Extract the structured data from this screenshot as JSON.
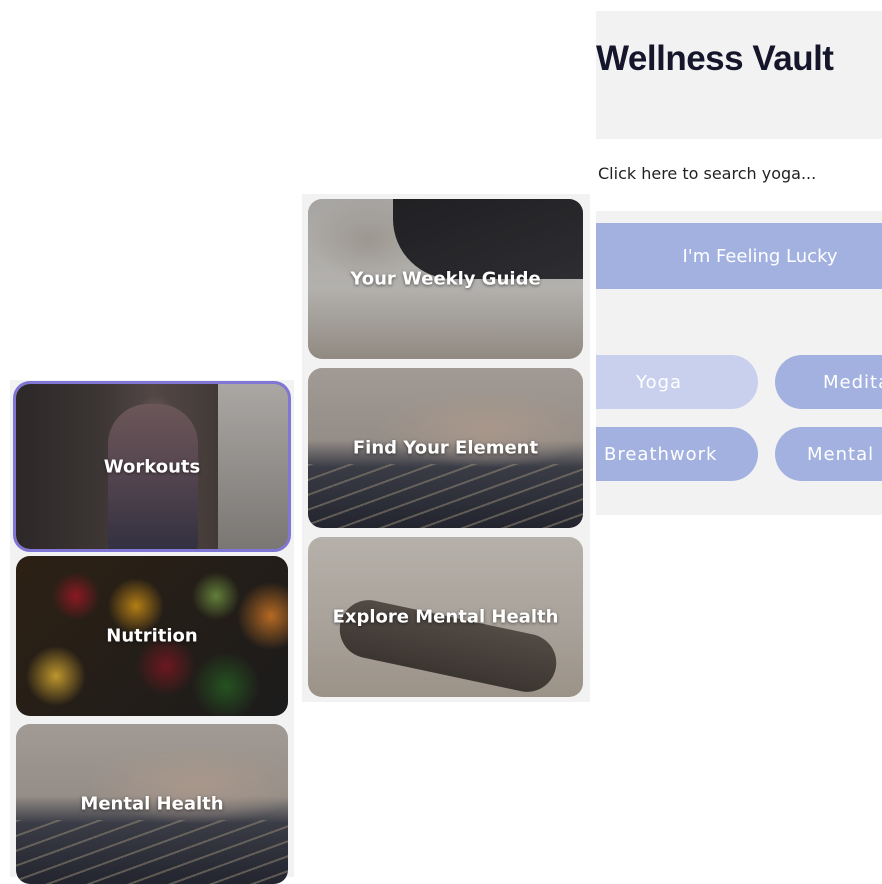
{
  "header": {
    "title": "Wellness Vault"
  },
  "search": {
    "placeholder": "Click here to search yoga..."
  },
  "actions": {
    "lucky_label": "I'm Feeling Lucky",
    "chips": [
      "Yoga",
      "Medita",
      "Breathwork",
      "Mental I"
    ]
  },
  "left_column": {
    "tiles": [
      {
        "label": "Workouts",
        "selected": true
      },
      {
        "label": "Nutrition"
      },
      {
        "label": "Mental Health"
      }
    ]
  },
  "middle_column": {
    "tiles": [
      {
        "label": "Your Weekly Guide"
      },
      {
        "label": "Find Your Element"
      },
      {
        "label": "Explore Mental Health"
      }
    ]
  },
  "colors": {
    "accent": "#a3b1e0",
    "chip_light": "#c8d0ee",
    "selected_outline": "#7f76d6",
    "title": "#15162b"
  }
}
